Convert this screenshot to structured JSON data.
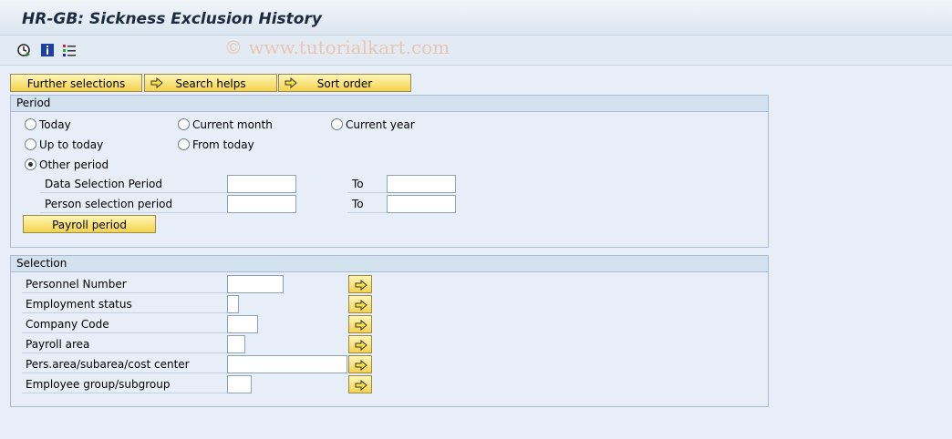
{
  "window": {
    "title": "HR-GB: Sickness Exclusion History"
  },
  "watermark": "© www.tutorialkart.com",
  "toolbar": {
    "icons": [
      "execute-icon",
      "info-icon",
      "program-selections-icon"
    ]
  },
  "tabs": {
    "further_selections": "Further selections",
    "search_helps": "Search helps",
    "sort_order": "Sort order"
  },
  "period": {
    "title": "Period",
    "options": {
      "today": "Today",
      "current_month": "Current month",
      "current_year": "Current year",
      "up_to_today": "Up to today",
      "from_today": "From today",
      "other_period": "Other period"
    },
    "selected": "Other period",
    "data_selection_label": "Data Selection Period",
    "person_selection_label": "Person selection period",
    "to_label": "To",
    "payroll_period_button": "Payroll period"
  },
  "selection": {
    "title": "Selection",
    "fields": {
      "personnel_number": "Personnel Number",
      "employment_status": "Employment status",
      "company_code": "Company Code",
      "payroll_area": "Payroll area",
      "pers_area": "Pers.area/subarea/cost center",
      "employee_group": "Employee group/subgroup"
    }
  },
  "colors": {
    "button": "#f4d24c",
    "background": "#e7eef7",
    "group_header": "#d4e1ef"
  }
}
